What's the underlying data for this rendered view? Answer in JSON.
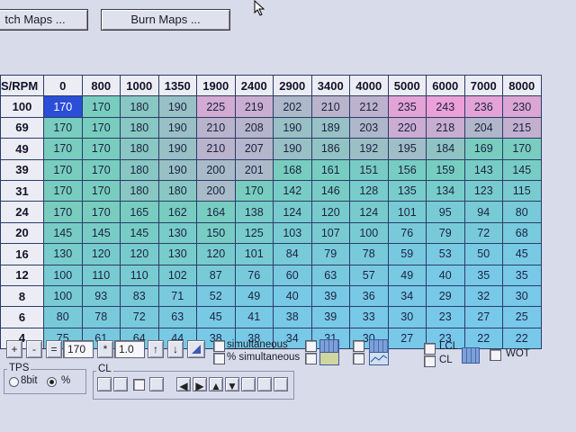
{
  "toolbar_top": {
    "batch_label": "tch Maps ...",
    "burn_label": "Burn Maps ..."
  },
  "table": {
    "corner_label": "S/RPM",
    "rpm": [
      "0",
      "800",
      "1000",
      "1350",
      "1900",
      "2400",
      "2900",
      "3400",
      "4000",
      "5000",
      "6000",
      "7000",
      "8000"
    ],
    "rows": [
      {
        "load": "100",
        "values": [
          170,
          170,
          180,
          190,
          225,
          219,
          202,
          210,
          212,
          235,
          243,
          236,
          230
        ]
      },
      {
        "load": "69",
        "values": [
          170,
          170,
          180,
          190,
          210,
          208,
          190,
          189,
          203,
          220,
          218,
          204,
          215
        ]
      },
      {
        "load": "49",
        "values": [
          170,
          170,
          180,
          190,
          210,
          207,
          190,
          186,
          192,
          195,
          184,
          169,
          170
        ]
      },
      {
        "load": "39",
        "values": [
          170,
          170,
          180,
          190,
          200,
          201,
          168,
          161,
          151,
          156,
          159,
          143,
          145
        ]
      },
      {
        "load": "31",
        "values": [
          170,
          170,
          180,
          180,
          200,
          170,
          142,
          146,
          128,
          135,
          134,
          123,
          115
        ]
      },
      {
        "load": "24",
        "values": [
          170,
          170,
          165,
          162,
          164,
          138,
          124,
          120,
          124,
          101,
          95,
          94,
          80
        ]
      },
      {
        "load": "20",
        "values": [
          145,
          145,
          145,
          130,
          150,
          125,
          103,
          107,
          100,
          76,
          79,
          72,
          68
        ]
      },
      {
        "load": "16",
        "values": [
          130,
          120,
          120,
          130,
          120,
          101,
          84,
          79,
          78,
          59,
          53,
          50,
          45
        ]
      },
      {
        "load": "12",
        "values": [
          100,
          110,
          110,
          102,
          87,
          76,
          60,
          63,
          57,
          49,
          40,
          35,
          35
        ]
      },
      {
        "load": "8",
        "values": [
          100,
          93,
          83,
          71,
          52,
          49,
          40,
          39,
          36,
          34,
          29,
          32,
          30
        ]
      },
      {
        "load": "6",
        "values": [
          80,
          78,
          72,
          63,
          45,
          41,
          38,
          39,
          33,
          30,
          23,
          27,
          25
        ]
      },
      {
        "load": "4",
        "values": [
          75,
          61,
          64,
          44,
          38,
          38,
          34,
          31,
          30,
          27,
          23,
          22,
          22
        ]
      }
    ]
  },
  "toolbar": {
    "plus": "+",
    "minus": "-",
    "equals": "=",
    "equals_value": "170",
    "multiply": "*",
    "multiply_value": "1.0",
    "up_arrow": "↑",
    "down_arrow": "↓",
    "simultaneous_label": "simultaneous",
    "pct_simultaneous_label": "% simultaneous",
    "lcl_label": "LCL",
    "cl_label": "CL",
    "wot_label": "WOT",
    "tps_label": "TPS",
    "tps_8bit_label": "8bit",
    "tps_pct_label": "%",
    "cl_group_label": "CL"
  }
}
